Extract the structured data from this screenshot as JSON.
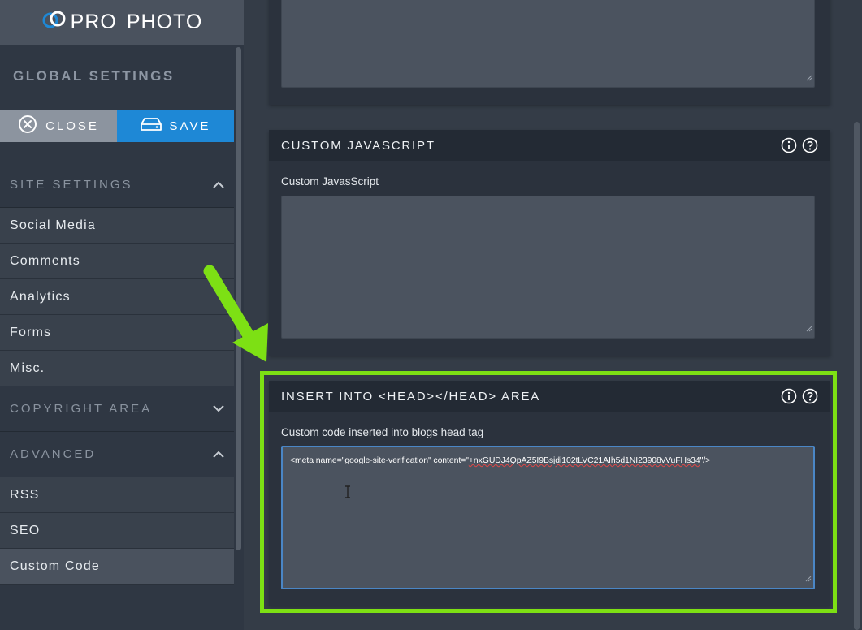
{
  "logo": {
    "part1": "PRO",
    "part2": "PHOTO",
    "icon": "prophoto-rings-icon"
  },
  "sidebar": {
    "title": "GLOBAL SETTINGS",
    "close_label": "CLOSE",
    "save_label": "SAVE",
    "sections": [
      {
        "label": "SITE SETTINGS",
        "expanded": true
      },
      {
        "label": "COPYRIGHT AREA",
        "expanded": false
      },
      {
        "label": "ADVANCED",
        "expanded": true
      }
    ],
    "site_items": [
      "Social Media",
      "Comments",
      "Analytics",
      "Forms",
      "Misc."
    ],
    "advanced_items": [
      "RSS",
      "SEO",
      "Custom Code"
    ],
    "active_item": "Custom Code"
  },
  "main": {
    "js_panel": {
      "title": "CUSTOM JAVASCRIPT",
      "label": "Custom JavasScript",
      "value": ""
    },
    "head_panel": {
      "title": "INSERT INTO <HEAD></HEAD> AREA",
      "label": "Custom code inserted into blogs head tag",
      "value_prefix": "<meta name=\"google-site-verification\" content=\"",
      "value_token": "+nxGUDJ4QpAZ5I9Bsjdi102tLVC21AIh5d1NI23908vVuFHs34",
      "value_suffix": "\"/>"
    }
  },
  "colors": {
    "accent_blue": "#1e88d6",
    "highlight_green": "#7de014",
    "sidebar_bg": "#2f3743",
    "panel_header_bg": "#232a34"
  }
}
